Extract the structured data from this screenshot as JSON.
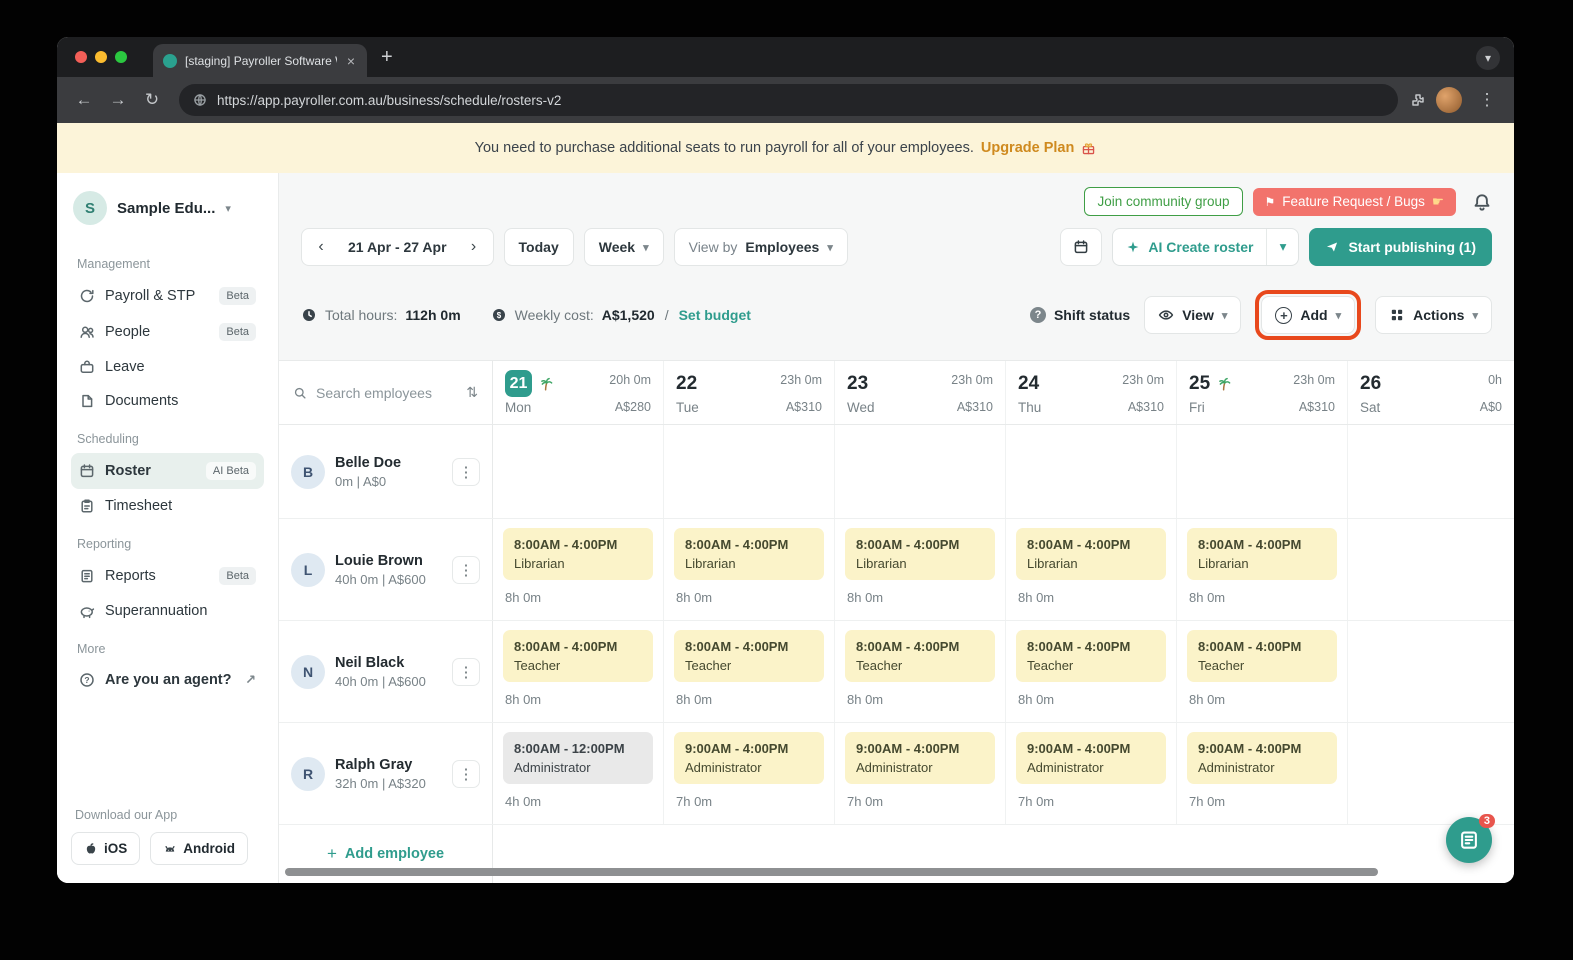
{
  "browser": {
    "tab_title": "[staging] Payroller Software W",
    "url": "https://app.payroller.com.au/business/schedule/rosters-v2"
  },
  "banner": {
    "message": "You need to purchase additional seats to run payroll for all of your employees.",
    "cta": "Upgrade Plan"
  },
  "header": {
    "join_group": "Join community group",
    "feature_request": "Feature Request / Bugs",
    "toolbar": {
      "date_range": "21 Apr - 27 Apr",
      "today": "Today",
      "view_mode": "Week",
      "view_by_label": "View by",
      "view_by_value": "Employees",
      "ai_create": "AI Create roster",
      "start_publishing": "Start publishing (1)"
    },
    "stats": {
      "total_hours_label": "Total hours:",
      "total_hours": "112h 0m",
      "weekly_cost_label": "Weekly cost:",
      "weekly_cost": "A$1,520",
      "separator": "/",
      "set_budget": "Set budget",
      "shift_status": "Shift status",
      "view": "View",
      "add": "Add",
      "actions": "Actions"
    }
  },
  "sidebar": {
    "workspace": {
      "initial": "S",
      "name": "Sample Edu..."
    },
    "sections": [
      {
        "label": "Management",
        "items": [
          {
            "icon": "payroll",
            "label": "Payroll & STP",
            "badge": "Beta"
          },
          {
            "icon": "people",
            "label": "People",
            "badge": "Beta"
          },
          {
            "icon": "leave",
            "label": "Leave"
          },
          {
            "icon": "documents",
            "label": "Documents"
          }
        ]
      },
      {
        "label": "Scheduling",
        "items": [
          {
            "icon": "roster",
            "label": "Roster",
            "badge": "AI Beta",
            "active": true
          },
          {
            "icon": "timesheet",
            "label": "Timesheet"
          }
        ]
      },
      {
        "label": "Reporting",
        "items": [
          {
            "icon": "reports",
            "label": "Reports",
            "badge": "Beta"
          },
          {
            "icon": "superannuation",
            "label": "Superannuation"
          }
        ]
      },
      {
        "label": "More",
        "items": [
          {
            "icon": "help",
            "label": "Are you an agent?",
            "trailing": "↗"
          }
        ]
      }
    ],
    "download": {
      "label": "Download our App",
      "ios": "iOS",
      "android": "Android"
    }
  },
  "grid": {
    "search_placeholder": "Search employees",
    "days": [
      {
        "date": "21",
        "dow": "Mon",
        "holiday": true,
        "today": true,
        "hours": "20h 0m",
        "cost": "A$280"
      },
      {
        "date": "22",
        "dow": "Tue",
        "hours": "23h 0m",
        "cost": "A$310"
      },
      {
        "date": "23",
        "dow": "Wed",
        "hours": "23h 0m",
        "cost": "A$310"
      },
      {
        "date": "24",
        "dow": "Thu",
        "hours": "23h 0m",
        "cost": "A$310"
      },
      {
        "date": "25",
        "dow": "Fri",
        "holiday": true,
        "hours": "23h 0m",
        "cost": "A$310"
      },
      {
        "date": "26",
        "dow": "Sat",
        "hours": "0h",
        "cost": "A$0"
      }
    ],
    "employees": [
      {
        "initial": "B",
        "name": "Belle Doe",
        "summary": "0m | A$0",
        "shifts": [
          null,
          null,
          null,
          null,
          null,
          null
        ]
      },
      {
        "initial": "L",
        "name": "Louie Brown",
        "summary": "40h 0m | A$600",
        "shifts": [
          {
            "time": "8:00AM - 4:00PM",
            "role": "Librarian",
            "duration": "8h 0m",
            "variant": "published"
          },
          {
            "time": "8:00AM - 4:00PM",
            "role": "Librarian",
            "duration": "8h 0m",
            "variant": "published"
          },
          {
            "time": "8:00AM - 4:00PM",
            "role": "Librarian",
            "duration": "8h 0m",
            "variant": "published"
          },
          {
            "time": "8:00AM - 4:00PM",
            "role": "Librarian",
            "duration": "8h 0m",
            "variant": "published"
          },
          {
            "time": "8:00AM - 4:00PM",
            "role": "Librarian",
            "duration": "8h 0m",
            "variant": "published"
          },
          null
        ]
      },
      {
        "initial": "N",
        "name": "Neil Black",
        "summary": "40h 0m | A$600",
        "shifts": [
          {
            "time": "8:00AM - 4:00PM",
            "role": "Teacher",
            "duration": "8h 0m",
            "variant": "published"
          },
          {
            "time": "8:00AM - 4:00PM",
            "role": "Teacher",
            "duration": "8h 0m",
            "variant": "published"
          },
          {
            "time": "8:00AM - 4:00PM",
            "role": "Teacher",
            "duration": "8h 0m",
            "variant": "published"
          },
          {
            "time": "8:00AM - 4:00PM",
            "role": "Teacher",
            "duration": "8h 0m",
            "variant": "published"
          },
          {
            "time": "8:00AM - 4:00PM",
            "role": "Teacher",
            "duration": "8h 0m",
            "variant": "published"
          },
          null
        ]
      },
      {
        "initial": "R",
        "name": "Ralph Gray",
        "summary": "32h 0m | A$320",
        "shifts": [
          {
            "time": "8:00AM - 12:00PM",
            "role": "Administrator",
            "duration": "4h 0m",
            "variant": "draft"
          },
          {
            "time": "9:00AM - 4:00PM",
            "role": "Administrator",
            "duration": "7h 0m",
            "variant": "published"
          },
          {
            "time": "9:00AM - 4:00PM",
            "role": "Administrator",
            "duration": "7h 0m",
            "variant": "published"
          },
          {
            "time": "9:00AM - 4:00PM",
            "role": "Administrator",
            "duration": "7h 0m",
            "variant": "published"
          },
          {
            "time": "9:00AM - 4:00PM",
            "role": "Administrator",
            "duration": "7h 0m",
            "variant": "published"
          },
          null
        ]
      }
    ],
    "add_employee": "Add employee"
  },
  "floating": {
    "badge": "3"
  },
  "colors": {
    "accent": "#2F9C8D",
    "highlight": "#E8481C",
    "shift_published": "#FBF3C9",
    "shift_draft": "#E9E9E9",
    "banner_cta": "#CF8A1F",
    "join_green": "#3F9E45",
    "feature_red": "#F2736C"
  }
}
